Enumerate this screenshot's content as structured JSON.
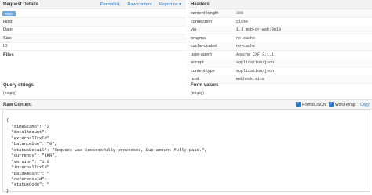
{
  "request": {
    "title": "Request Details",
    "links": [
      "Permalink",
      "Raw content",
      "Export as ▾"
    ],
    "method_badge": "POST",
    "rows": [
      "Host",
      "Date",
      "Size",
      "ID"
    ],
    "files_title": "Files",
    "query_title": "Query strings",
    "query_value": "(empty)"
  },
  "headers": {
    "title": "Headers",
    "rows": [
      {
        "name": "content-length",
        "value": "309"
      },
      {
        "name": "connection",
        "value": "close"
      },
      {
        "name": "via",
        "value": "1.1 mob-dr-web:9010"
      },
      {
        "name": "pragma",
        "value": "no-cache"
      },
      {
        "name": "cache-control",
        "value": "no-cache"
      },
      {
        "name": "user-agent",
        "value": "Apache CXF 3.1.1"
      },
      {
        "name": "accept",
        "value": "application/json"
      },
      {
        "name": "content-type",
        "value": "application/json"
      },
      {
        "name": "host",
        "value": "webhook.site"
      }
    ],
    "form_title": "Form values",
    "form_value": "(empty)"
  },
  "raw": {
    "title": "Raw Content",
    "format_json": "Format JSON",
    "word_wrap": "Word-Wrap",
    "copy": "Copy",
    "lines": [
      "{",
      "  \"timeStamp\": \"2",
      "  \"totalAmount\":",
      "  \"externalTrxId\"",
      "  \"balanceDue\": \"0\",",
      "  \"statusDetail\": \"Request was Successfully processed, Due amount fully paid.\",",
      "  \"currency\": \"LKR\",",
      "  \"version\": \"1.0\",",
      "  \"internalTrxId\"",
      "  \"paidAmount\": \"",
      "  \"referenceId\": \"",
      "  \"statusCode\": \"",
      "}"
    ]
  },
  "colors": {
    "accent": "#2a78c4",
    "badge": "#6fa8dc"
  }
}
